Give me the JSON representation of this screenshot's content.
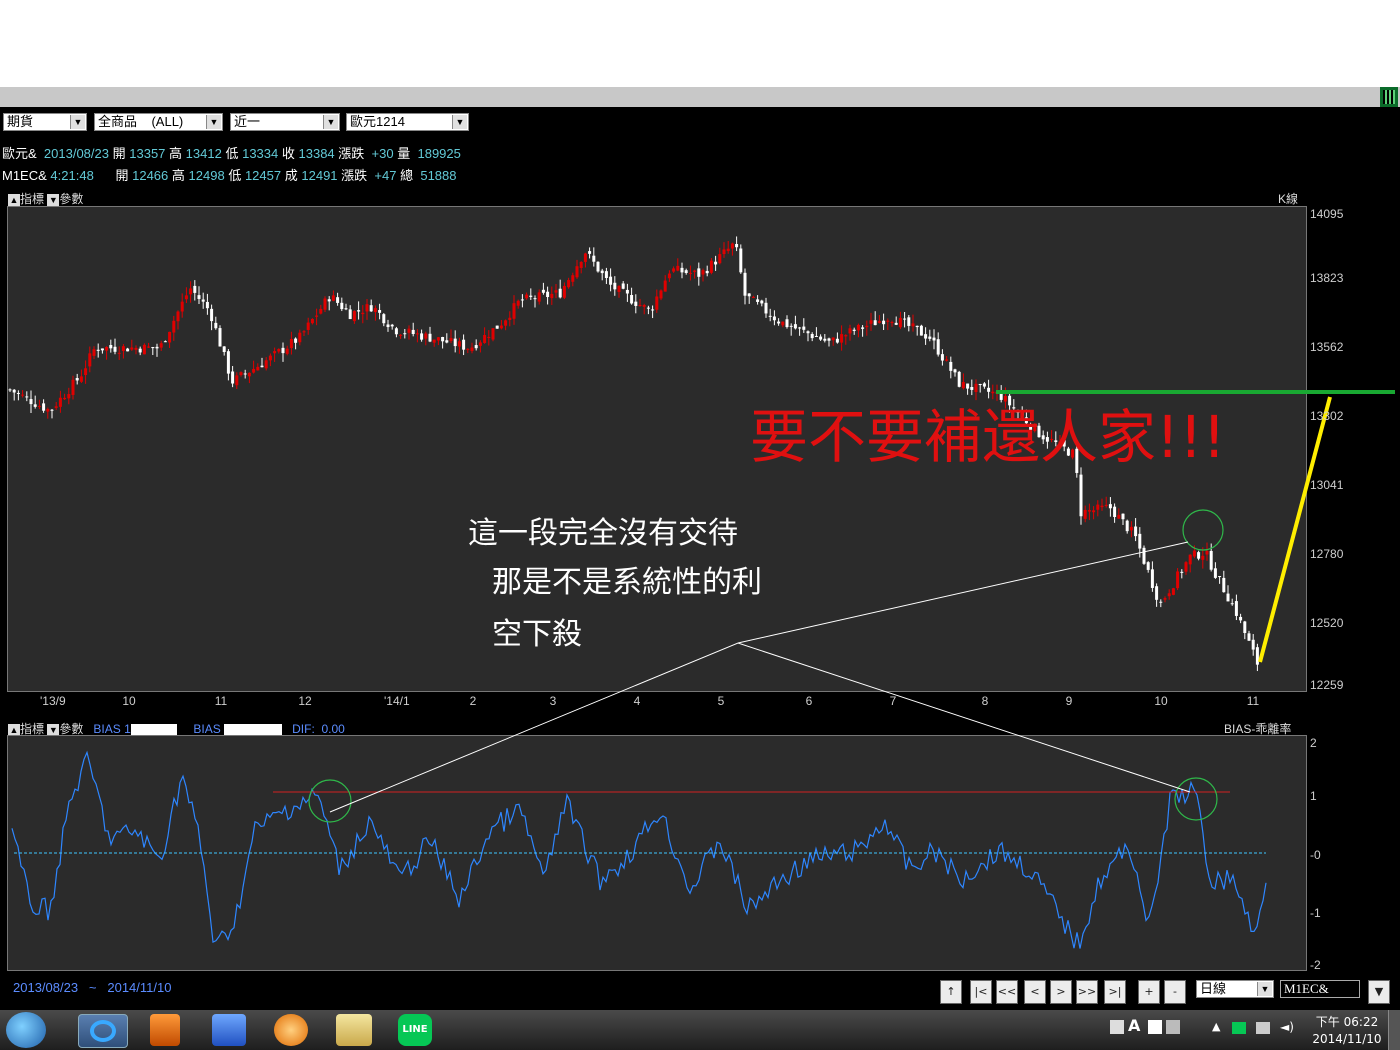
{
  "toolbar": {
    "market": "期貨",
    "products": "全商品",
    "all": "(ALL)",
    "range": "近一",
    "symbol": "歐元1214"
  },
  "quote1": {
    "name": "歐元&",
    "date": "2013/08/23",
    "open_lbl": "開",
    "open": "13357",
    "high_lbl": "高",
    "high": "13412",
    "low_lbl": "低",
    "low": "13334",
    "close_lbl": "收",
    "close": "13384",
    "chg_lbl": "漲跌",
    "chg": "+30",
    "vol_lbl": "量",
    "vol": "189925"
  },
  "quote2": {
    "name": "M1EC&",
    "time": "4:21:48",
    "open_lbl": "開",
    "open": "12466",
    "high_lbl": "高",
    "high": "12498",
    "low_lbl": "低",
    "low": "12457",
    "close_lbl": "成",
    "close": "12491",
    "chg_lbl": "漲跌",
    "chg": "+47",
    "vol_lbl": "總",
    "vol": "51888"
  },
  "price_panel": {
    "indicator_btn": "指標",
    "param_btn": "參數",
    "label": "K線",
    "y_ticks": [
      "14095",
      "13823",
      "13562",
      "13302",
      "13041",
      "12780",
      "12520",
      "12259"
    ],
    "x_ticks": [
      "'13/9",
      "10",
      "11",
      "12",
      "'14/1",
      "2",
      "3",
      "4",
      "5",
      "6",
      "7",
      "8",
      "9",
      "10",
      "11"
    ]
  },
  "bias_panel": {
    "indicator_btn": "指標",
    "param_btn": "參數",
    "bias1": "BIAS 1",
    "bias2": "BIAS",
    "dif": "DIF:",
    "dif_val": "0.00",
    "label": "BIAS-乖離率",
    "y_ticks": [
      "2",
      "1",
      "-0",
      "-1",
      "-2"
    ]
  },
  "footer": {
    "from": "2013/08/23",
    "tilde": "~",
    "to": "2014/11/10",
    "buttons": [
      "↑",
      "|<",
      "<<",
      "<",
      ">",
      ">>",
      ">|",
      "+",
      "-"
    ],
    "period": "日線",
    "code": "M1EC&"
  },
  "annotations": {
    "headline": "要不要補還人家!!!",
    "note1": "這一段完全沒有交待",
    "note2": "那是不是系統性的利",
    "note3": "空下殺"
  },
  "taskbar": {
    "time_prefix": "下午",
    "time": "06:22",
    "date": "2014/11/10",
    "tray_a": "A"
  },
  "chart_data": {
    "type": "candlestick",
    "y_range": [
      12259,
      14095
    ],
    "bias_range": [
      -2,
      2
    ],
    "colors": {
      "up": "#e00000",
      "down": "#ffffff",
      "bias": "#2e86ff",
      "zero": "#3fc7ff",
      "green_line": "#19a832",
      "yellow_line": "#ffee00",
      "headline": "#e01010"
    }
  }
}
